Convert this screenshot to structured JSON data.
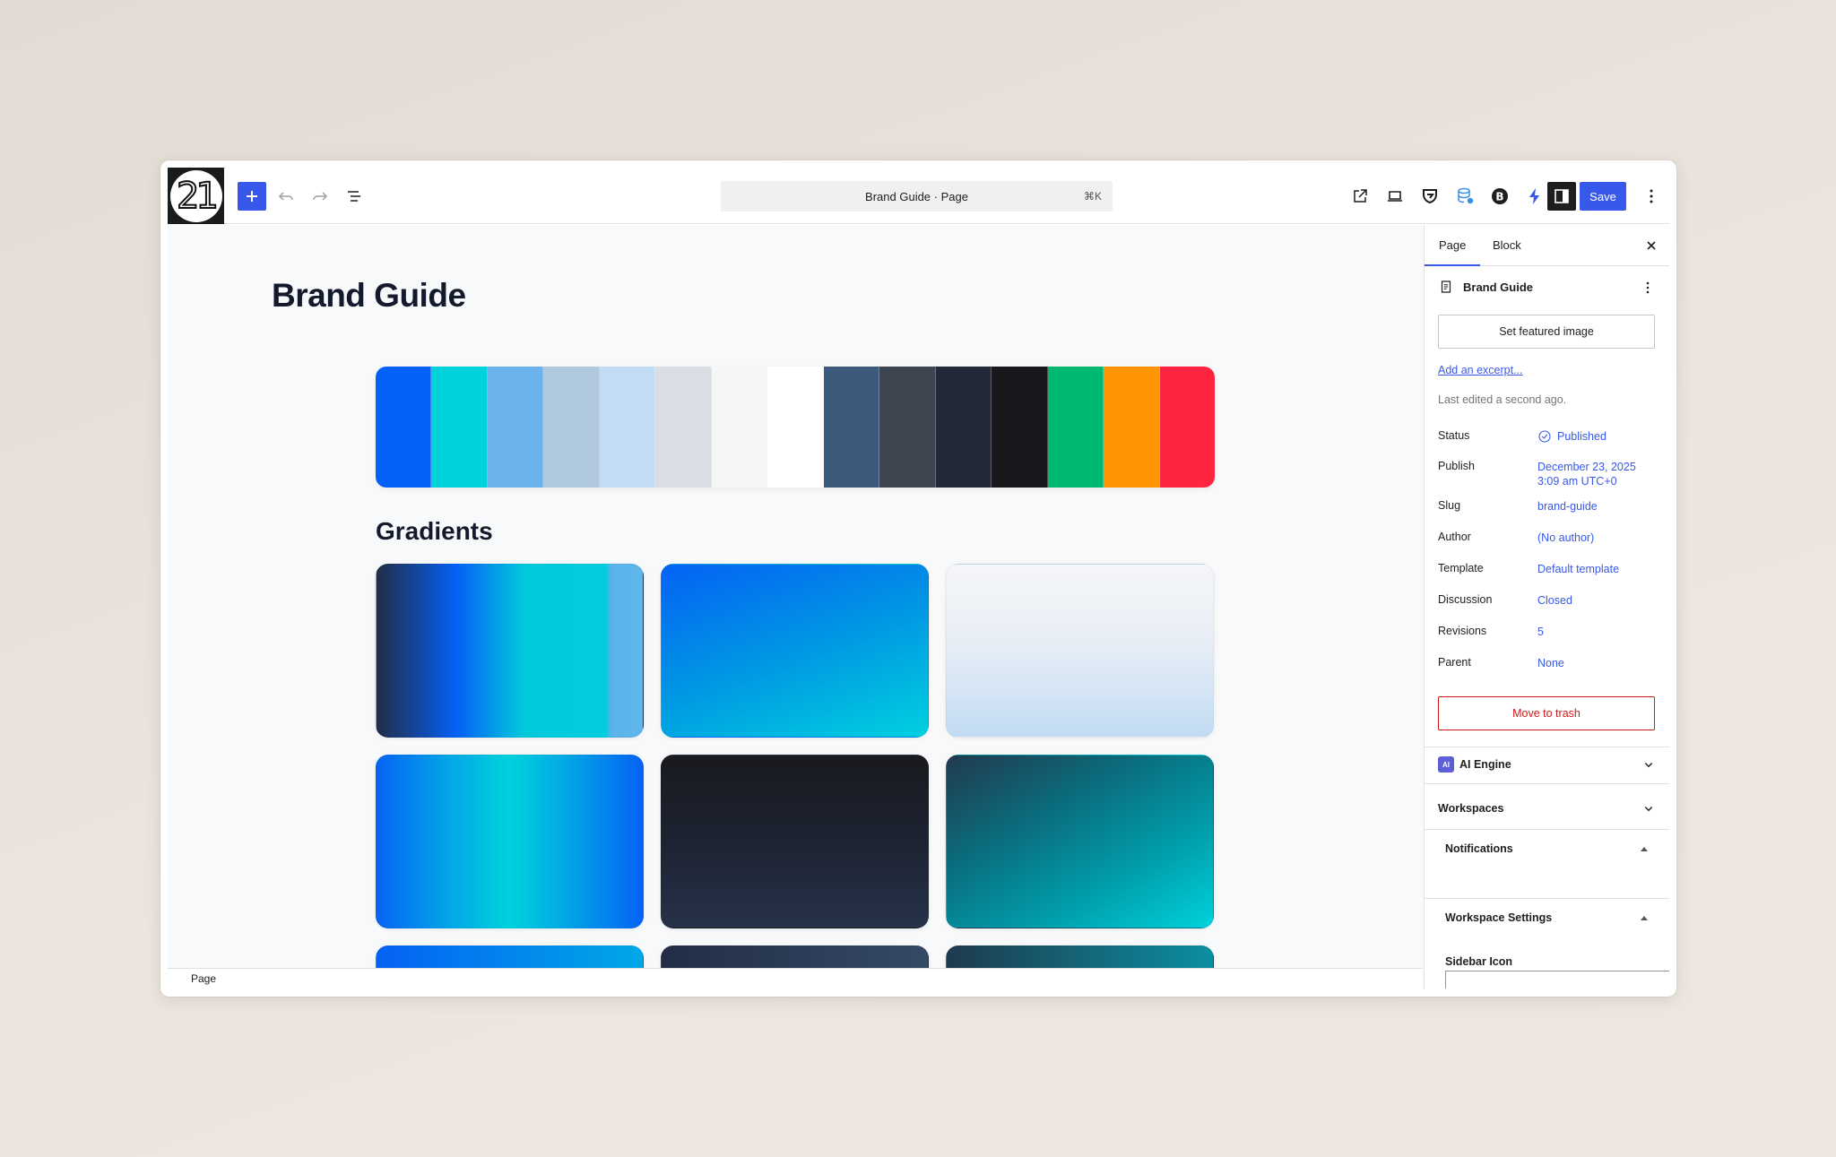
{
  "topbar": {
    "logo_text": "21",
    "command_title": "Brand Guide · Page",
    "command_shortcut": "⌘K",
    "save_label": "Save"
  },
  "canvas": {
    "title": "Brand Guide",
    "palette": [
      "#0461f7",
      "#00d2dc",
      "#69b2ec",
      "#b1c9dc",
      "#c2dcf4",
      "#d9dee4",
      "#f4f6f8",
      "#ffffff",
      "#3c5b7c",
      "#3d4550",
      "#24293a",
      "#19191d",
      "#00b971",
      "#ff9500",
      "#ff2540"
    ],
    "gradients_heading": "Gradients",
    "gradients": [
      "linear-gradient(90deg, #222d45 0%, #0460f5 30%, #02c8dc 55%, #02cddf 86%, #5ab3ea 88%, #5fb6ea 100%)",
      "linear-gradient(160deg, #0462f4 0%, #009ce2 55%, #00d0e0 100%)",
      "linear-gradient(180deg, #f5f6f8 0%, #e8eef6 45%, #c2dcf4 100%)",
      "linear-gradient(90deg, #0664f4 0%, #02a8e6 28%, #00d2dc 50%, #02a5e6 72%, #0463f4 100%)",
      "linear-gradient(180deg, #1a1a1f 0%, #1d2332 50%, #263249 100%)",
      "linear-gradient(150deg, #213a4e 0%, #0a6d7d 35%, #00a0ad 70%, #00d2dc 100%)",
      "linear-gradient(90deg, #0462f4 0%, #00a8e6 100%)",
      "linear-gradient(90deg, #222d45 0%, #354a66 100%)",
      "linear-gradient(90deg, #1e3a4d 0%, #0b8fa1 100%)"
    ]
  },
  "footer": {
    "label": "Page"
  },
  "sidebar": {
    "tabs": [
      "Page",
      "Block"
    ],
    "doc_title": "Brand Guide",
    "featured_image_label": "Set featured image",
    "excerpt_label": "Add an excerpt...",
    "last_edited": "Last edited a second ago.",
    "meta": [
      {
        "label": "Status",
        "value": "Published"
      },
      {
        "label": "Publish",
        "value": "December 23, 2025\n3:09 am UTC+0"
      },
      {
        "label": "Slug",
        "value": "brand-guide"
      },
      {
        "label": "Author",
        "value": "(No author)"
      },
      {
        "label": "Template",
        "value": "Default template"
      },
      {
        "label": "Discussion",
        "value": "Closed"
      },
      {
        "label": "Revisions",
        "value": "5"
      },
      {
        "label": "Parent",
        "value": "None"
      }
    ],
    "trash_label": "Move to trash",
    "ai_engine_label": "AI Engine",
    "ai_badge": "AI",
    "workspaces_label": "Workspaces",
    "notifications_label": "Notifications",
    "workspace_settings_label": "Workspace Settings",
    "sidebar_icon_label": "Sidebar Icon"
  },
  "colors": {
    "accent": "#3858e9",
    "danger": "#cc1818"
  }
}
